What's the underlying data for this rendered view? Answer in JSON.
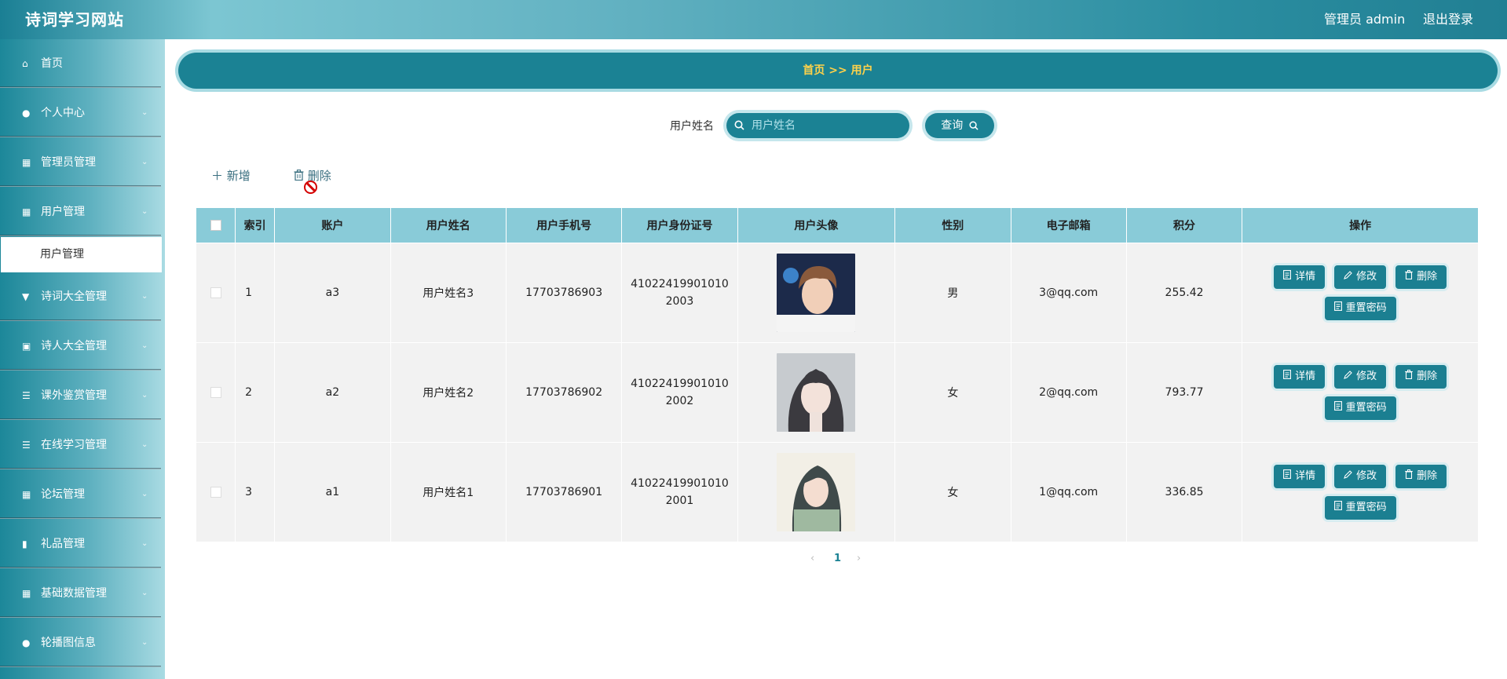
{
  "header": {
    "title": "诗词学习网站",
    "user": "管理员 admin",
    "logout": "退出登录"
  },
  "sidebar": {
    "items": [
      {
        "label": "首页",
        "icon": "home-icon",
        "glyph": "⌂",
        "chevron": false
      },
      {
        "label": "个人中心",
        "icon": "user-icon",
        "glyph": "●",
        "chevron": true
      },
      {
        "label": "管理员管理",
        "icon": "grid-icon",
        "glyph": "▦",
        "chevron": true
      },
      {
        "label": "用户管理",
        "icon": "grid-icon",
        "glyph": "▦",
        "chevron": true
      },
      {
        "label": "诗词大全管理",
        "icon": "brush-icon",
        "glyph": "▼",
        "chevron": true
      },
      {
        "label": "诗人大全管理",
        "icon": "clipboard-icon",
        "glyph": "▣",
        "chevron": true
      },
      {
        "label": "课外鉴赏管理",
        "icon": "list-icon",
        "glyph": "☰",
        "chevron": true
      },
      {
        "label": "在线学习管理",
        "icon": "list-icon",
        "glyph": "☰",
        "chevron": true
      },
      {
        "label": "论坛管理",
        "icon": "grid-icon",
        "glyph": "▦",
        "chevron": true
      },
      {
        "label": "礼品管理",
        "icon": "bar-chart-icon",
        "glyph": "▮",
        "chevron": true
      },
      {
        "label": "基础数据管理",
        "icon": "grid-icon",
        "glyph": "▦",
        "chevron": true
      },
      {
        "label": "轮播图信息",
        "icon": "bulb-icon",
        "glyph": "●",
        "chevron": true
      }
    ],
    "active_sub": "用户管理"
  },
  "breadcrumb": "首页  >>  用户",
  "search": {
    "label": "用户姓名",
    "placeholder": "用户姓名",
    "button": "查询"
  },
  "toolbar": {
    "add": "新增",
    "delete": "删除"
  },
  "table": {
    "headers": [
      "索引",
      "账户",
      "用户姓名",
      "用户手机号",
      "用户身份证号",
      "用户头像",
      "性别",
      "电子邮箱",
      "积分",
      "操作"
    ],
    "rows": [
      {
        "index": "1",
        "account": "a3",
        "name": "用户姓名3",
        "phone": "17703786903",
        "idcard": "410224199010102003",
        "gender": "男",
        "email": "3@qq.com",
        "points": "255.42",
        "avatar": "boy"
      },
      {
        "index": "2",
        "account": "a2",
        "name": "用户姓名2",
        "phone": "17703786902",
        "idcard": "410224199010102002",
        "gender": "女",
        "email": "2@qq.com",
        "points": "793.77",
        "avatar": "girl-bangs"
      },
      {
        "index": "3",
        "account": "a1",
        "name": "用户姓名1",
        "phone": "17703786901",
        "idcard": "410224199010102001",
        "gender": "女",
        "email": "1@qq.com",
        "points": "336.85",
        "avatar": "girl-art"
      }
    ],
    "actions": {
      "detail": "详情",
      "edit": "修改",
      "delete": "删除",
      "reset": "重置密码"
    }
  },
  "pager": {
    "current": "1"
  },
  "colors": {
    "primary": "#1b8294",
    "header_cell": "#89cbd8",
    "breadcrumb_text": "#ffd24a",
    "active_page": "#1b8294"
  }
}
